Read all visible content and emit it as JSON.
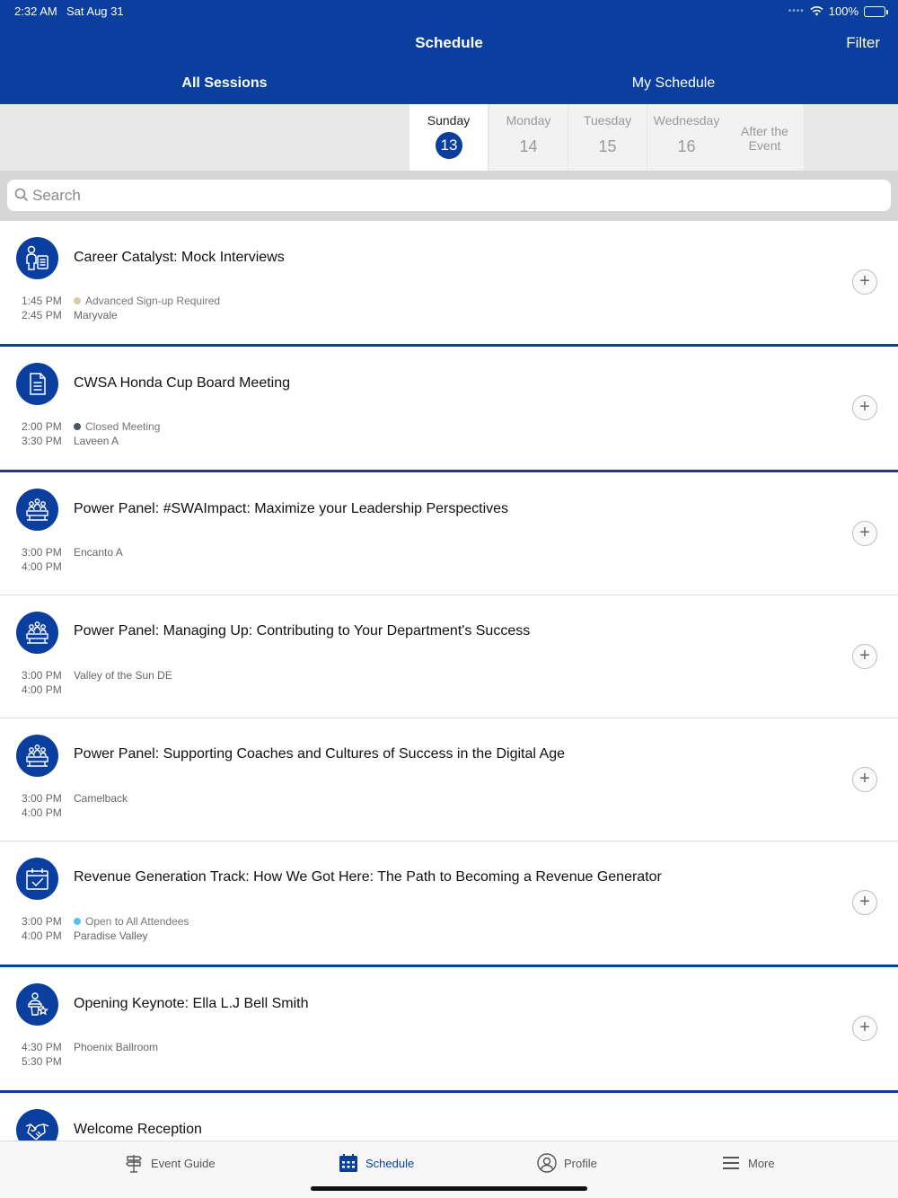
{
  "status": {
    "time": "2:32 AM",
    "date": "Sat Aug 31",
    "battery": "100%"
  },
  "nav": {
    "title": "Schedule",
    "filter": "Filter"
  },
  "segments": {
    "all": "All Sessions",
    "mine": "My Schedule"
  },
  "days": [
    {
      "name": "Sunday",
      "num": "13"
    },
    {
      "name": "Monday",
      "num": "14"
    },
    {
      "name": "Tuesday",
      "num": "15"
    },
    {
      "name": "Wednesday",
      "num": "16"
    },
    {
      "name": "After the Event",
      "num": ""
    }
  ],
  "search": {
    "placeholder": "Search"
  },
  "sessions": [
    {
      "title": "Career Catalyst: Mock Interviews",
      "start": "1:45 PM",
      "end": "2:45 PM",
      "tag": "Advanced Sign-up Required",
      "tag_color": "#d9c9a8",
      "location": "Maryvale",
      "icon": "interview-icon"
    },
    {
      "title": "CWSA Honda Cup Board Meeting",
      "start": "2:00 PM",
      "end": "3:30 PM",
      "tag": "Closed Meeting",
      "tag_color": "#4a5568",
      "location": "Laveen A",
      "icon": "document-icon"
    },
    {
      "title": "Power Panel: #SWAImpact: Maximize your Leadership Perspectives",
      "start": "3:00 PM",
      "end": "4:00 PM",
      "tag": "",
      "tag_color": "",
      "location": "Encanto A",
      "icon": "panel-icon"
    },
    {
      "title": "Power Panel: Managing Up: Contributing to Your Department's Success",
      "start": "3:00 PM",
      "end": "4:00 PM",
      "tag": "",
      "tag_color": "",
      "location": "Valley of the Sun DE",
      "icon": "panel-icon"
    },
    {
      "title": "Power Panel: Supporting Coaches and Cultures of Success in the Digital Age",
      "start": "3:00 PM",
      "end": "4:00 PM",
      "tag": "",
      "tag_color": "",
      "location": "Camelback",
      "icon": "panel-icon"
    },
    {
      "title": "Revenue Generation Track: How We Got Here: The Path to Becoming a Revenue Generator",
      "start": "3:00 PM",
      "end": "4:00 PM",
      "tag": "Open to All Attendees",
      "tag_color": "#5bc0eb",
      "location": "Paradise Valley",
      "icon": "calendar-check-icon"
    },
    {
      "title": "Opening Keynote: Ella L.J Bell Smith",
      "start": "4:30 PM",
      "end": "5:30 PM",
      "tag": "",
      "tag_color": "",
      "location": "Phoenix Ballroom",
      "icon": "keynote-icon"
    },
    {
      "title": "Welcome Reception",
      "start": "",
      "end": "",
      "tag": "",
      "tag_color": "",
      "location": "",
      "icon": "handshake-icon"
    }
  ],
  "tabs": {
    "guide": "Event Guide",
    "schedule": "Schedule",
    "profile": "Profile",
    "more": "More"
  },
  "colors": {
    "brand": "#0a3fa0"
  }
}
